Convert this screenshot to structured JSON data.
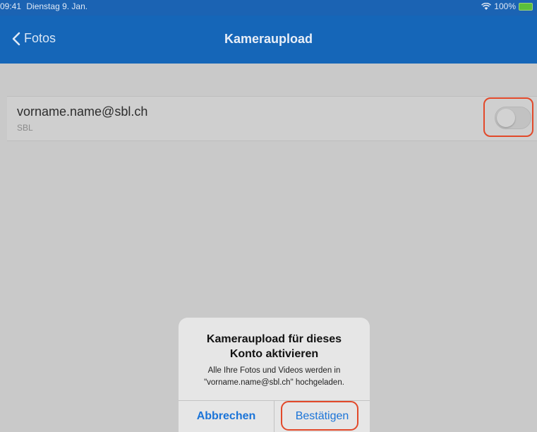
{
  "status_bar": {
    "time": "09:41",
    "date": "Dienstag 9. Jan.",
    "battery": "100%"
  },
  "nav": {
    "back_label": "Fotos",
    "title": "Kameraupload"
  },
  "account": {
    "email": "vorname.name@sbl.ch",
    "org": "SBL",
    "camera_upload_enabled": false
  },
  "dialog": {
    "title_line1": "Kameraupload für dieses",
    "title_line2": "Konto aktivieren",
    "message_line1": "Alle Ihre Fotos und Videos werden in",
    "message_line2": "\"vorname.name@sbl.ch\" hochgeladen.",
    "cancel_label": "Abbrechen",
    "confirm_label": "Bestätigen"
  },
  "colors": {
    "nav_background": "#1566b8",
    "highlight": "#e2492a",
    "action_blue": "#1b74d8"
  }
}
